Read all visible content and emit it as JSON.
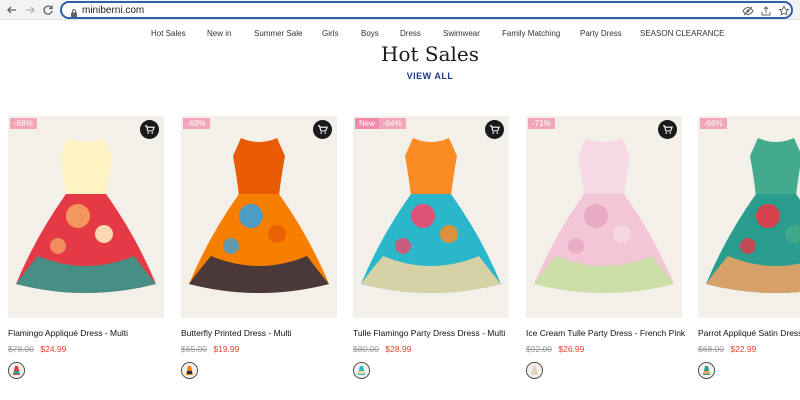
{
  "browser": {
    "url": "miniberni.com"
  },
  "nav": {
    "items": [
      "Hot Sales",
      "New in",
      "Summer Sale",
      "Girls",
      "Boys",
      "Dress",
      "Swimwear",
      "Family Matching",
      "Party Dress",
      "SEASON CLEARANCE"
    ]
  },
  "section": {
    "title": "Hot Sales",
    "view_all": "VIEW ALL"
  },
  "products": [
    {
      "name": "Flamingo Appliqué Dress - Multi",
      "badge": "-68%",
      "new_badge": "",
      "old_price": "$78.00",
      "price": "$24.99",
      "palette": [
        "#e63946",
        "#f4a261",
        "#2a9d8f",
        "#fff3c4"
      ]
    },
    {
      "name": "Butterfly Printed Dress - Multi",
      "badge": "-69%",
      "new_badge": "",
      "old_price": "$65.00",
      "price": "$19.99",
      "palette": [
        "#f77f00",
        "#3aa0d8",
        "#2b2d42",
        "#e85d04"
      ]
    },
    {
      "name": "Tulle Flamingo Party Dress Dress - Multi",
      "badge": "-64%",
      "new_badge": "New",
      "old_price": "$80.00",
      "price": "$28.99",
      "palette": [
        "#2ab7ca",
        "#ef476f",
        "#f6d6a0",
        "#fb8b24"
      ]
    },
    {
      "name": "Ice Cream Tulle Party Dress - French Pink",
      "badge": "-71%",
      "new_badge": "",
      "old_price": "$92.00",
      "price": "$26.99",
      "palette": [
        "#f2c6d6",
        "#e8a6c2",
        "#c7e3a0",
        "#f7d9e6"
      ]
    },
    {
      "name": "Parrot Appliqué Satin Dress",
      "badge": "-66%",
      "new_badge": "",
      "old_price": "$68.00",
      "price": "$22.99",
      "palette": [
        "#2a9d8f",
        "#e63946",
        "#f4a261",
        "#43aa8b"
      ]
    }
  ]
}
